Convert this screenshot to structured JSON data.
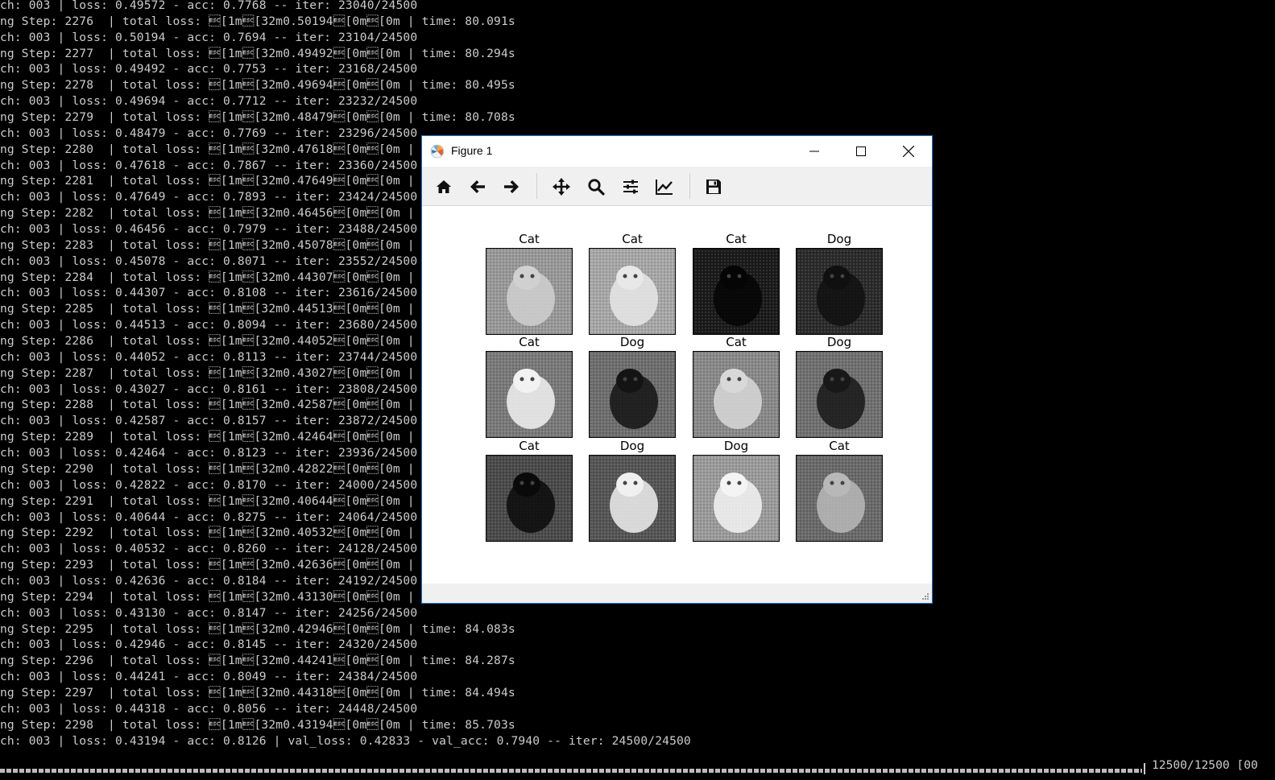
{
  "terminal": {
    "lines": [
      "ch: 003 | loss: 0.49572 - acc: 0.7768 -- iter: 23040/24500",
      "ng Step: 2276  | total loss: \u001b[1m\u001b[32m0.50194\u001b[0m\u001b[0m | time: 80.091s",
      "ch: 003 | loss: 0.50194 - acc: 0.7694 -- iter: 23104/24500",
      "ng Step: 2277  | total loss: \u001b[1m\u001b[32m0.49492\u001b[0m\u001b[0m | time: 80.294s",
      "ch: 003 | loss: 0.49492 - acc: 0.7753 -- iter: 23168/24500",
      "ng Step: 2278  | total loss: \u001b[1m\u001b[32m0.49694\u001b[0m\u001b[0m | time: 80.495s",
      "ch: 003 | loss: 0.49694 - acc: 0.7712 -- iter: 23232/24500",
      "ng Step: 2279  | total loss: \u001b[1m\u001b[32m0.48479\u001b[0m\u001b[0m | time: 80.708s",
      "ch: 003 | loss: 0.48479 - acc: 0.7769 -- iter: 23296/24500",
      "ng Step: 2280  | total loss: \u001b[1m\u001b[32m0.47618\u001b[0m\u001b[0m | tim",
      "ch: 003 | loss: 0.47618 - acc: 0.7867 -- iter: 23360/24500",
      "ng Step: 2281  | total loss: \u001b[1m\u001b[32m0.47649\u001b[0m\u001b[0m | tim",
      "ch: 003 | loss: 0.47649 - acc: 0.7893 -- iter: 23424/24500",
      "ng Step: 2282  | total loss: \u001b[1m\u001b[32m0.46456\u001b[0m\u001b[0m | tim",
      "ch: 003 | loss: 0.46456 - acc: 0.7979 -- iter: 23488/24500",
      "ng Step: 2283  | total loss: \u001b[1m\u001b[32m0.45078\u001b[0m\u001b[0m | tim",
      "ch: 003 | loss: 0.45078 - acc: 0.8071 -- iter: 23552/24500",
      "ng Step: 2284  | total loss: \u001b[1m\u001b[32m0.44307\u001b[0m\u001b[0m | tim",
      "ch: 003 | loss: 0.44307 - acc: 0.8108 -- iter: 23616/24500",
      "ng Step: 2285  | total loss: \u001b[1m\u001b[32m0.44513\u001b[0m\u001b[0m | tim",
      "ch: 003 | loss: 0.44513 - acc: 0.8094 -- iter: 23680/24500",
      "ng Step: 2286  | total loss: \u001b[1m\u001b[32m0.44052\u001b[0m\u001b[0m | tim",
      "ch: 003 | loss: 0.44052 - acc: 0.8113 -- iter: 23744/24500",
      "ng Step: 2287  | total loss: \u001b[1m\u001b[32m0.43027\u001b[0m\u001b[0m | tim",
      "ch: 003 | loss: 0.43027 - acc: 0.8161 -- iter: 23808/24500",
      "ng Step: 2288  | total loss: \u001b[1m\u001b[32m0.42587\u001b[0m\u001b[0m | tim",
      "ch: 003 | loss: 0.42587 - acc: 0.8157 -- iter: 23872/24500",
      "ng Step: 2289  | total loss: \u001b[1m\u001b[32m0.42464\u001b[0m\u001b[0m | tim",
      "ch: 003 | loss: 0.42464 - acc: 0.8123 -- iter: 23936/24500",
      "ng Step: 2290  | total loss: \u001b[1m\u001b[32m0.42822\u001b[0m\u001b[0m | tim",
      "ch: 003 | loss: 0.42822 - acc: 0.8170 -- iter: 24000/24500",
      "ng Step: 2291  | total loss: \u001b[1m\u001b[32m0.40644\u001b[0m\u001b[0m | tim",
      "ch: 003 | loss: 0.40644 - acc: 0.8275 -- iter: 24064/24500",
      "ng Step: 2292  | total loss: \u001b[1m\u001b[32m0.40532\u001b[0m\u001b[0m | tim",
      "ch: 003 | loss: 0.40532 - acc: 0.8260 -- iter: 24128/24500",
      "ng Step: 2293  | total loss: \u001b[1m\u001b[32m0.42636\u001b[0m\u001b[0m | tim",
      "ch: 003 | loss: 0.42636 - acc: 0.8184 -- iter: 24192/24500",
      "ng Step: 2294  | total loss: \u001b[1m\u001b[32m0.43130\u001b[0m\u001b[0m | tim",
      "ch: 003 | loss: 0.43130 - acc: 0.8147 -- iter: 24256/24500",
      "ng Step: 2295  | total loss: \u001b[1m\u001b[32m0.42946\u001b[0m\u001b[0m | time: 84.083s",
      "ch: 003 | loss: 0.42946 - acc: 0.8145 -- iter: 24320/24500",
      "ng Step: 2296  | total loss: \u001b[1m\u001b[32m0.44241\u001b[0m\u001b[0m | time: 84.287s",
      "ch: 003 | loss: 0.44241 - acc: 0.8049 -- iter: 24384/24500",
      "ng Step: 2297  | total loss: \u001b[1m\u001b[32m0.44318\u001b[0m\u001b[0m | time: 84.494s",
      "ch: 003 | loss: 0.44318 - acc: 0.8056 -- iter: 24448/24500",
      "ng Step: 2298  | total loss: \u001b[1m\u001b[32m0.43194\u001b[0m\u001b[0m | time: 85.703s",
      "ch: 003 | loss: 0.43194 - acc: 0.8126 | val_loss: 0.42833 - val_acc: 0.7940 -- iter: 24500/24500"
    ],
    "progress_text": "12500/12500 [00"
  },
  "window": {
    "title": "Figure 1",
    "app_icon": "matplotlib-icon",
    "controls": {
      "minimize": "minimize-icon",
      "maximize": "maximize-icon",
      "close": "close-icon"
    }
  },
  "toolbar": {
    "tools": [
      {
        "name": "home",
        "icon": "home-icon"
      },
      {
        "name": "back",
        "icon": "arrow-left-icon"
      },
      {
        "name": "forward",
        "icon": "arrow-right-icon"
      },
      {
        "name": "pan",
        "icon": "move-icon"
      },
      {
        "name": "zoom",
        "icon": "search-icon"
      },
      {
        "name": "subplots",
        "icon": "sliders-icon"
      },
      {
        "name": "edit-axes",
        "icon": "chart-line-icon"
      },
      {
        "name": "save",
        "icon": "save-icon"
      }
    ]
  },
  "figure": {
    "grid": [
      [
        {
          "label": "Cat"
        },
        {
          "label": "Cat"
        },
        {
          "label": "Cat"
        },
        {
          "label": "Dog"
        }
      ],
      [
        {
          "label": "Cat"
        },
        {
          "label": "Dog"
        },
        {
          "label": "Cat"
        },
        {
          "label": "Dog"
        }
      ],
      [
        {
          "label": "Cat"
        },
        {
          "label": "Dog"
        },
        {
          "label": "Dog"
        },
        {
          "label": "Cat"
        }
      ]
    ]
  },
  "colors": {
    "terminal_bg": "#000000",
    "terminal_fg": "#cccccc",
    "window_border": "#1a73c8",
    "toolbar_bg": "#f0f0f0"
  }
}
